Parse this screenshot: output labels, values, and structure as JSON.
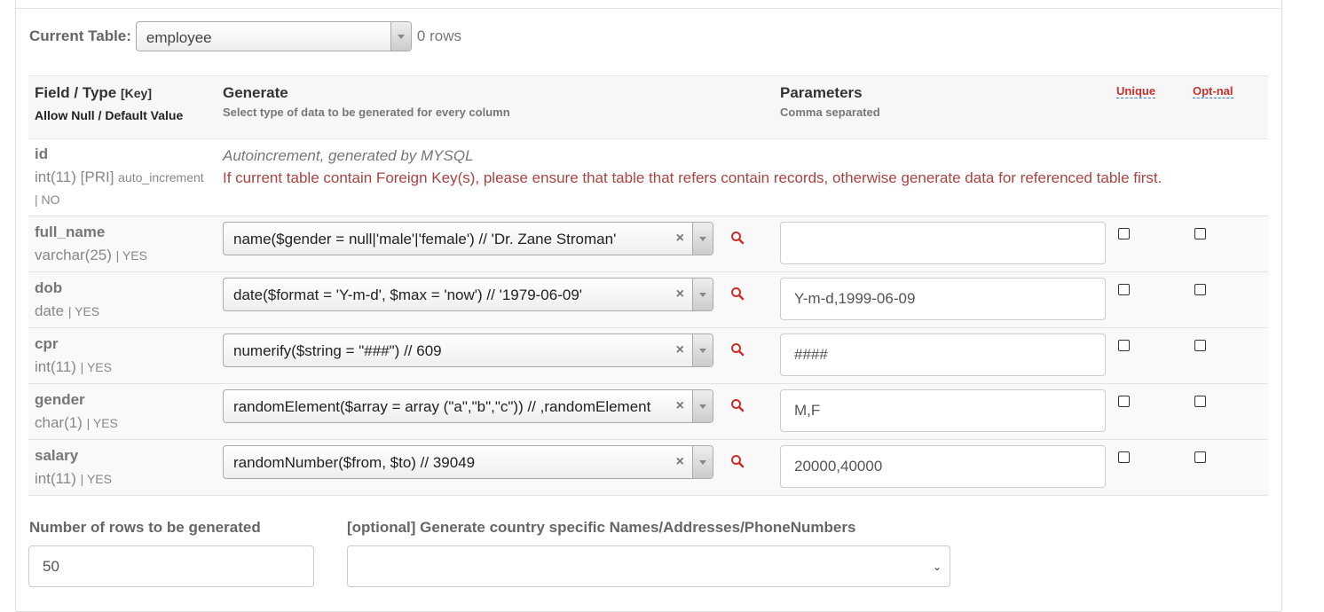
{
  "current_table": {
    "label": "Current Table:",
    "value": "employee",
    "rows": "0 rows"
  },
  "header": {
    "field_type": "Field / Type",
    "key": "[Key]",
    "allow_null": "Allow Null / Default Value",
    "generate": "Generate",
    "generate_sub": "Select type of data to be generated for every column",
    "parameters": "Parameters",
    "parameters_sub": "Comma separated",
    "unique": "Unique",
    "optional": "Opt-nal"
  },
  "id_row": {
    "name": "id",
    "type": "int(11) [PRI]",
    "extra": "auto_increment",
    "null": "| NO",
    "auto_note": "Autoincrement, generated by MYSQL",
    "fk_note": "If current table contain Foreign Key(s), please ensure that table that refers contain records, otherwise generate data for referenced table first."
  },
  "rows": [
    {
      "name": "full_name",
      "type": "varchar(25)",
      "null": "| YES",
      "generator": "name($gender = null|'male'|'female') // 'Dr. Zane Stroman'",
      "param": "",
      "param_placeholder": ""
    },
    {
      "name": "dob",
      "type": "date",
      "null": "| YES",
      "generator": "date($format = 'Y-m-d', $max = 'now') // '1979-06-09'",
      "param": "Y-m-d,1999-06-09"
    },
    {
      "name": "cpr",
      "type": "int(11)",
      "null": "| YES",
      "generator": "numerify($string = \"###\") // 609",
      "param": "####"
    },
    {
      "name": "gender",
      "type": "char(1)",
      "null": "| YES",
      "generator": "randomElement($array = array (\"a\",\"b\",\"c\")) // ,randomElement",
      "param": "M,F"
    },
    {
      "name": "salary",
      "type": "int(11)",
      "null": "| YES",
      "generator": "randomNumber($from, $to) // 39049",
      "param": "20000,40000"
    }
  ],
  "bottom": {
    "rows_label": "Number of rows to be generated",
    "rows_value": "50",
    "country_label": "[optional] Generate country specific Names/Addresses/PhoneNumbers",
    "country_value": ""
  },
  "colors": {
    "error_text": "#a94442",
    "search_icon": "#c9302c",
    "tooltip_label": "#c9302c"
  },
  "icons": {
    "search": "search-icon",
    "clear": "clear-icon",
    "dropdown": "chevron-down-icon"
  }
}
